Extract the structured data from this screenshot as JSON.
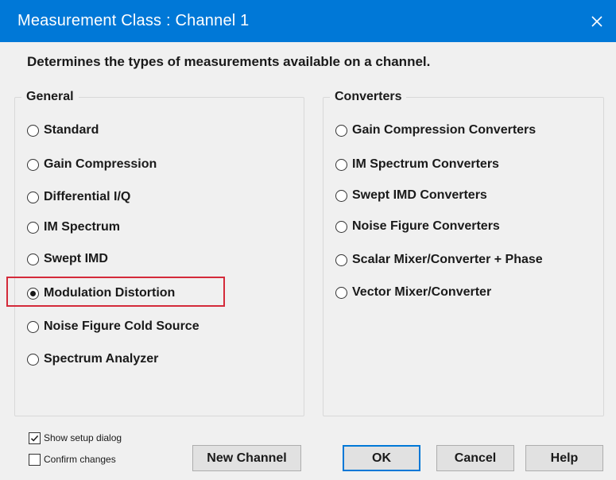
{
  "window": {
    "title": "Measurement Class : Channel 1",
    "close_glyph": "✕"
  },
  "description": "Determines the types of measurements available on a channel.",
  "general": {
    "legend": "General",
    "options": [
      {
        "label": "Standard",
        "selected": false
      },
      {
        "label": "Gain Compression",
        "selected": false
      },
      {
        "label": "Differential I/Q",
        "selected": false
      },
      {
        "label": "IM Spectrum",
        "selected": false
      },
      {
        "label": "Swept IMD",
        "selected": false
      },
      {
        "label": "Modulation Distortion",
        "selected": true
      },
      {
        "label": "Noise Figure Cold Source",
        "selected": false
      },
      {
        "label": "Spectrum Analyzer",
        "selected": false
      }
    ]
  },
  "converters": {
    "legend": "Converters",
    "options": [
      {
        "label": "Gain Compression Converters",
        "selected": false
      },
      {
        "label": "IM Spectrum Converters",
        "selected": false
      },
      {
        "label": "Swept IMD Converters",
        "selected": false
      },
      {
        "label": "Noise Figure Converters",
        "selected": false
      },
      {
        "label": "Scalar Mixer/Converter + Phase",
        "selected": false
      },
      {
        "label": "Vector Mixer/Converter",
        "selected": false
      }
    ]
  },
  "checkboxes": {
    "show_setup": {
      "label": "Show setup dialog",
      "checked": true
    },
    "confirm_changes": {
      "label": "Confirm changes",
      "checked": false
    }
  },
  "buttons": {
    "new_channel": "New Channel",
    "ok": "OK",
    "cancel": "Cancel",
    "help": "Help"
  },
  "colors": {
    "titlebar": "#0078d7",
    "highlight": "#d42a3a",
    "dialog_bg": "#f0f0f0"
  }
}
